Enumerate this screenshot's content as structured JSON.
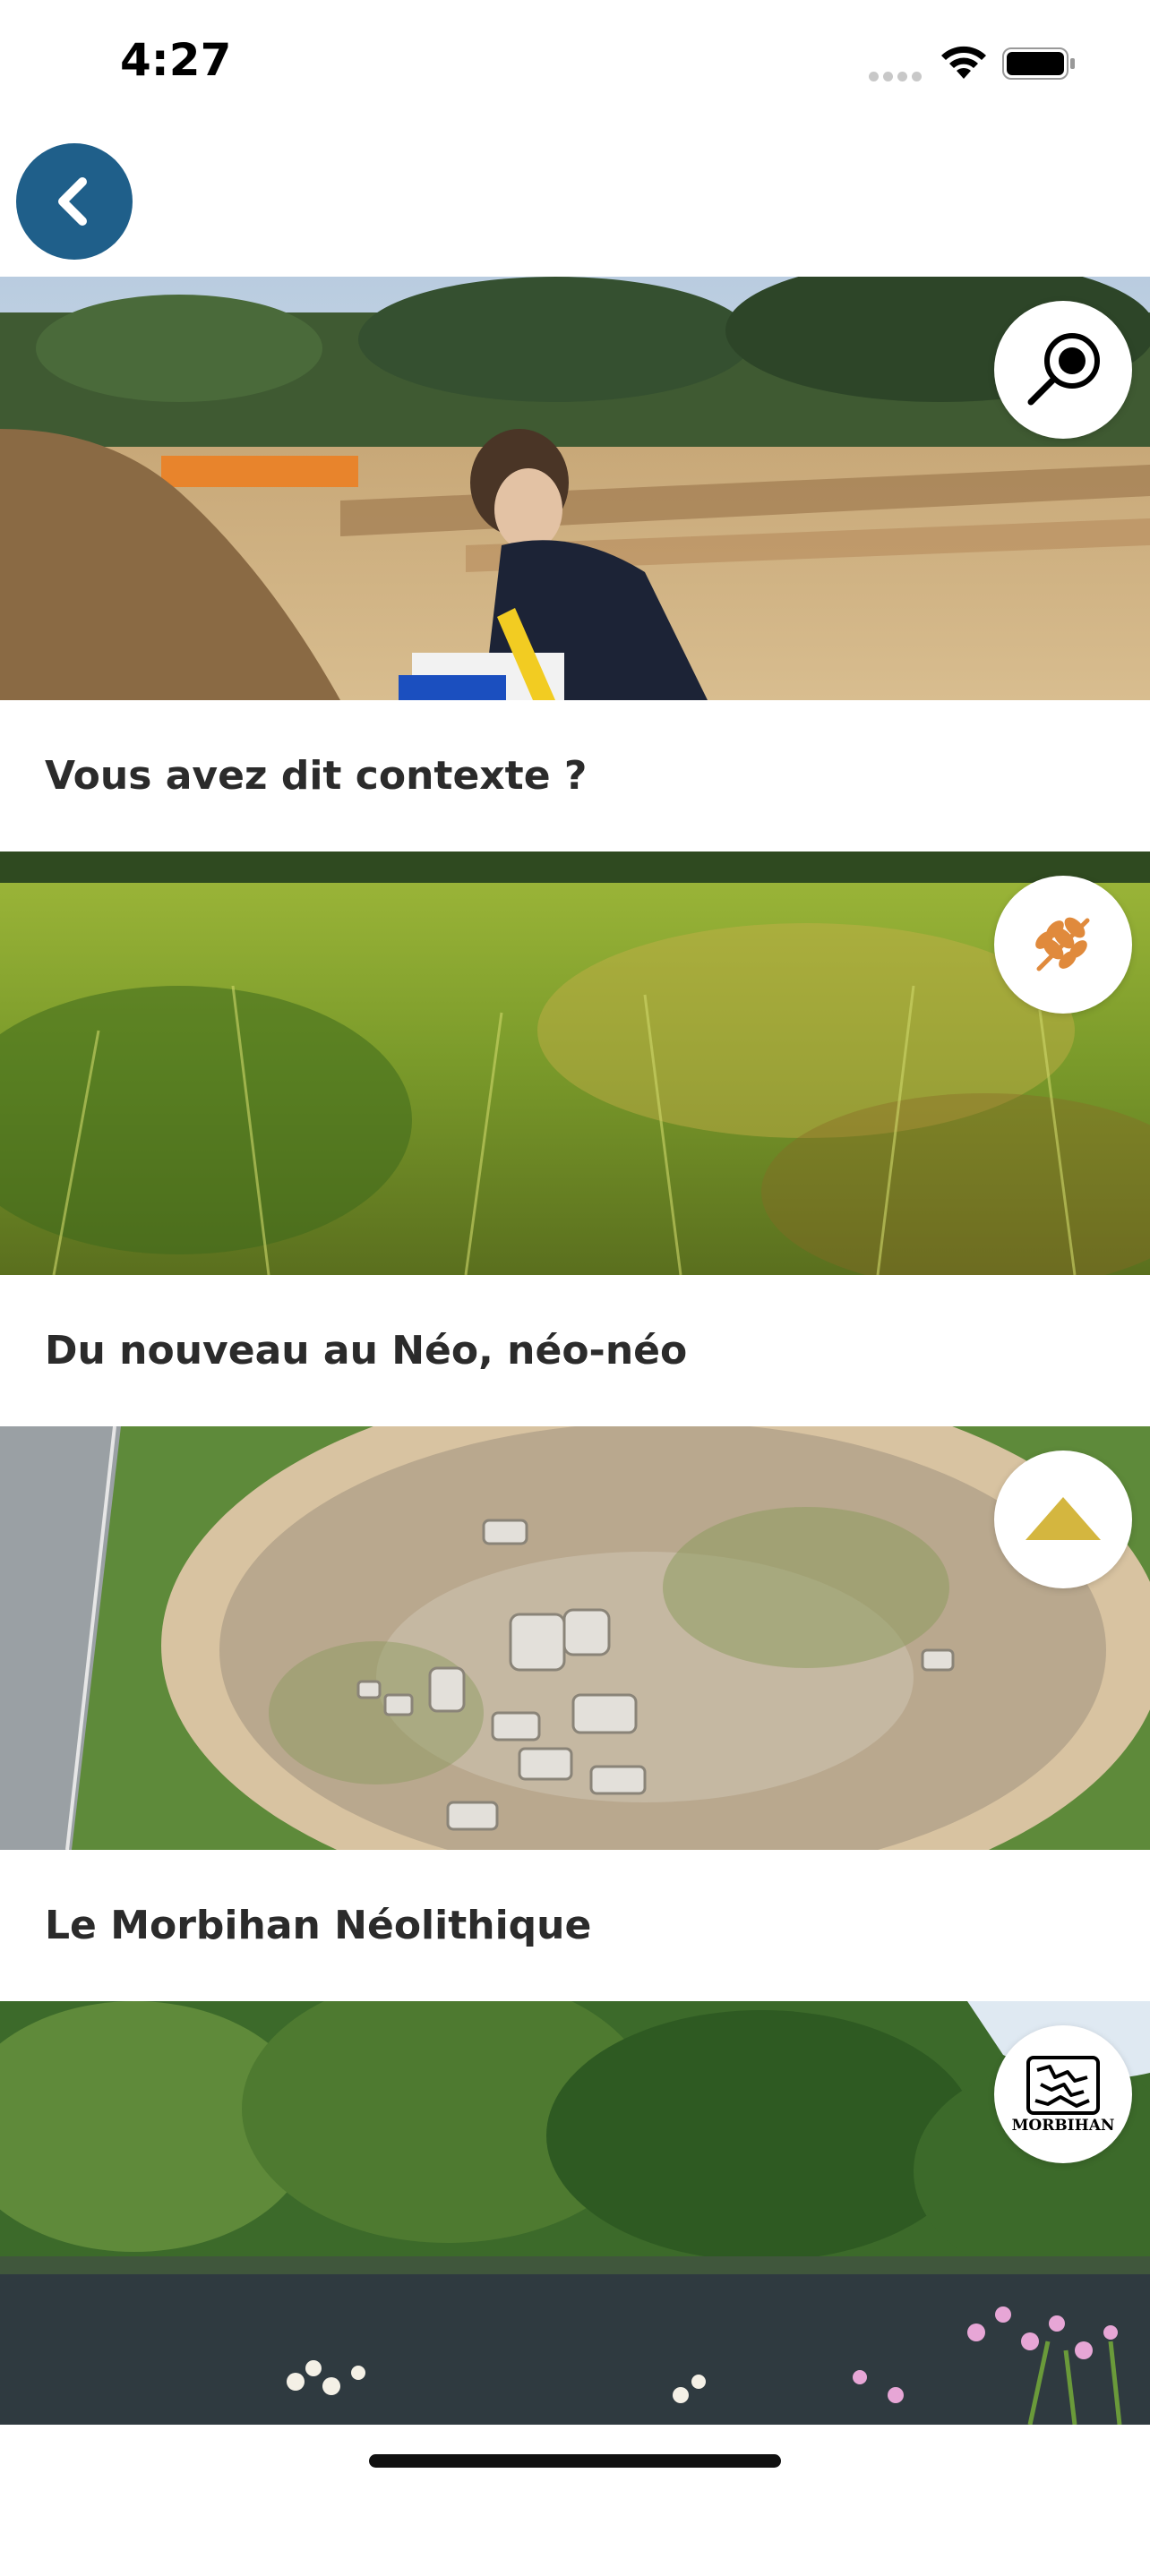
{
  "status_bar": {
    "time": "4:27"
  },
  "header": {
    "back_label": "Back"
  },
  "cards": [
    {
      "title": "Vous avez dit contexte ?",
      "badge_icon": "magnifier-icon"
    },
    {
      "title": "Du nouveau au Néo, néo-néo",
      "badge_icon": "wheat-icon"
    },
    {
      "title": "Le Morbihan Néolithique",
      "badge_icon": "tumulus-icon"
    },
    {
      "title": "",
      "badge_icon": "morbihan-map-icon",
      "badge_text": "MORBIHAN"
    }
  ],
  "colors": {
    "accent": "#1f5f8a",
    "title_text": "#2b2b2b",
    "badge_gold": "#d4b63f",
    "wheat_orange": "#e08a3c"
  }
}
